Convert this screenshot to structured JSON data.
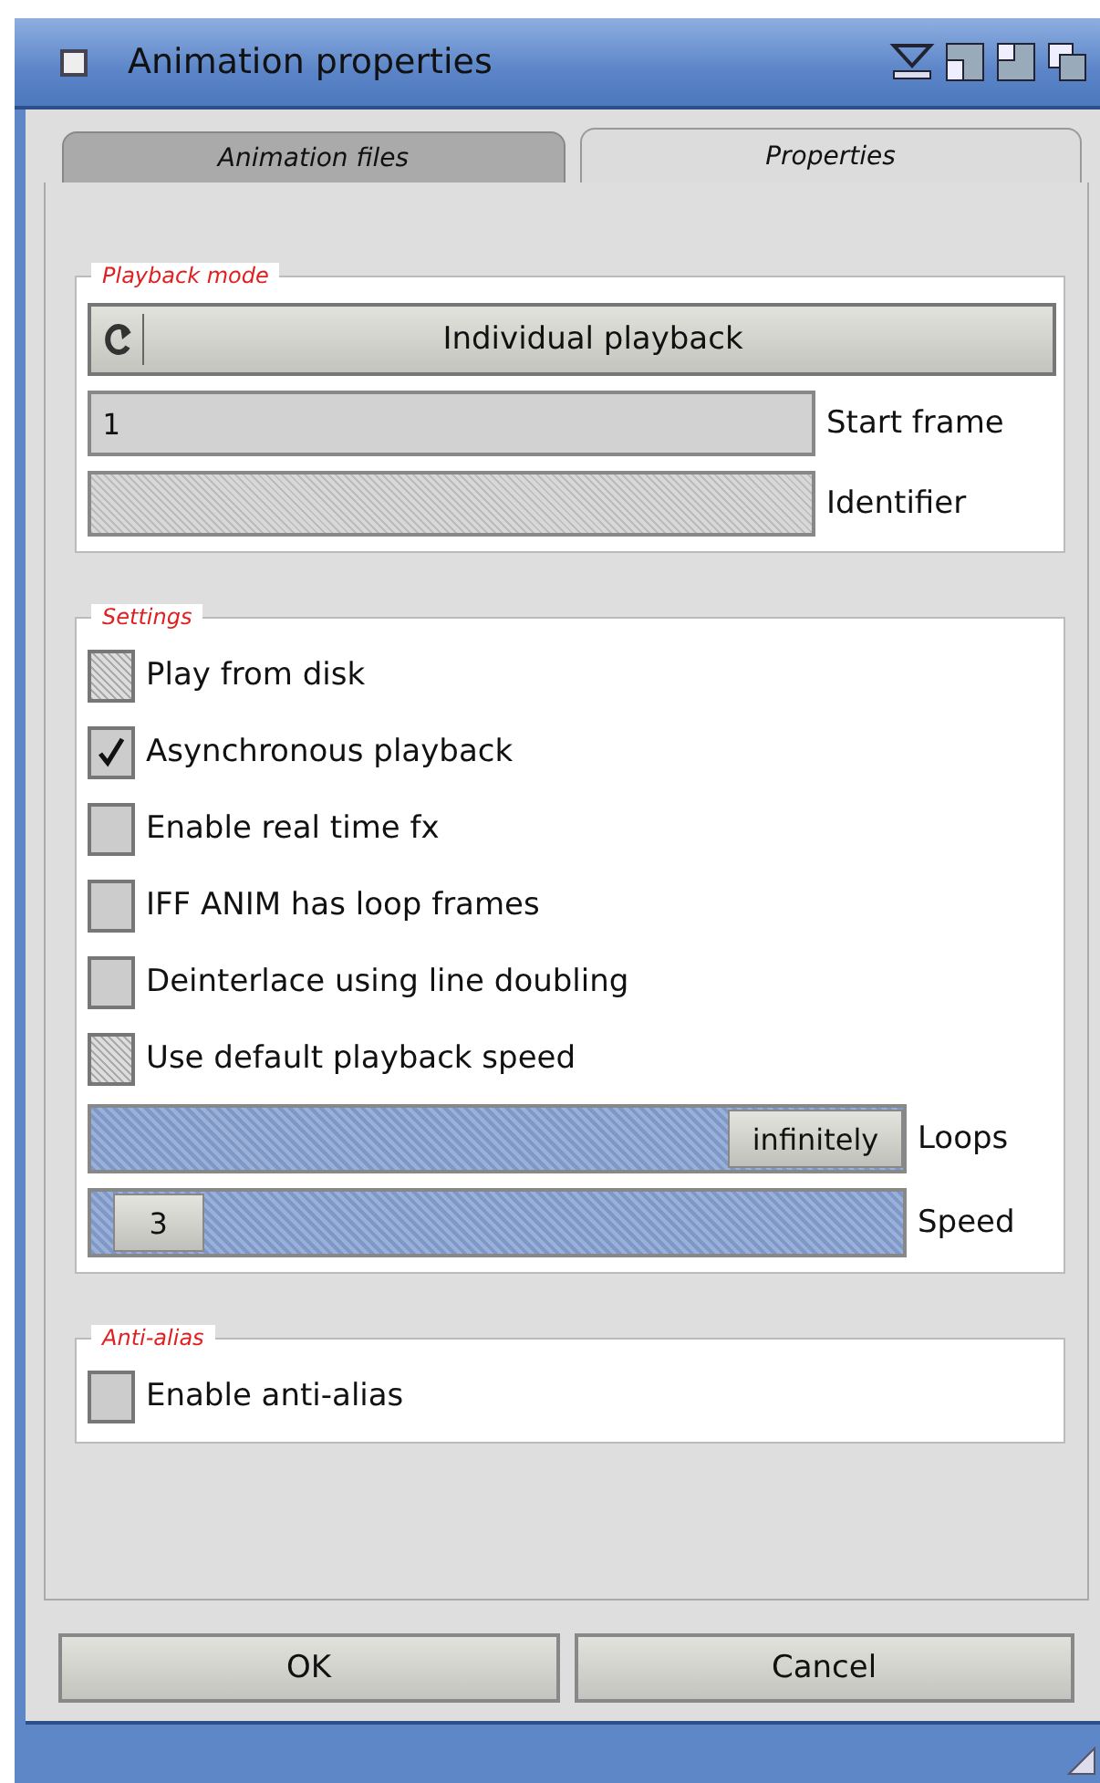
{
  "window": {
    "title": "Animation properties"
  },
  "tabs": [
    {
      "label": "Animation files",
      "selected": false
    },
    {
      "label": "Properties",
      "selected": true
    }
  ],
  "playback_mode": {
    "legend": "Playback mode",
    "cycle": {
      "value": "Individual playback"
    },
    "fields": [
      {
        "label": "Start frame",
        "value": "1",
        "disabled": false
      },
      {
        "label": "Identifier",
        "disabled": true
      }
    ]
  },
  "settings": {
    "legend": "Settings",
    "items": [
      {
        "kind": "checkbox",
        "label": "Play from disk",
        "checked": false,
        "disabled": true
      },
      {
        "kind": "checkbox",
        "label": "Asynchronous playback",
        "checked": true,
        "disabled": false
      },
      {
        "kind": "checkbox",
        "label": "Enable real time fx",
        "checked": false,
        "disabled": false
      },
      {
        "kind": "checkbox",
        "label": "IFF ANIM has loop frames",
        "checked": false,
        "disabled": false
      },
      {
        "kind": "checkbox",
        "label": "Deinterlace using line doubling",
        "checked": false,
        "disabled": false
      },
      {
        "kind": "checkbox",
        "label": "Use default playback speed",
        "checked": false,
        "disabled": true
      },
      {
        "kind": "slider",
        "label": "Loops",
        "value": "infinitely",
        "level": 1
      },
      {
        "kind": "slider",
        "label": "Speed",
        "value": "3",
        "level": 0.03
      }
    ]
  },
  "anti_alias": {
    "legend": "Anti-alias",
    "items": [
      {
        "kind": "checkbox",
        "label": "Enable anti-alias",
        "checked": false,
        "disabled": false
      }
    ]
  },
  "buttons": [
    "OK",
    "Cancel"
  ]
}
